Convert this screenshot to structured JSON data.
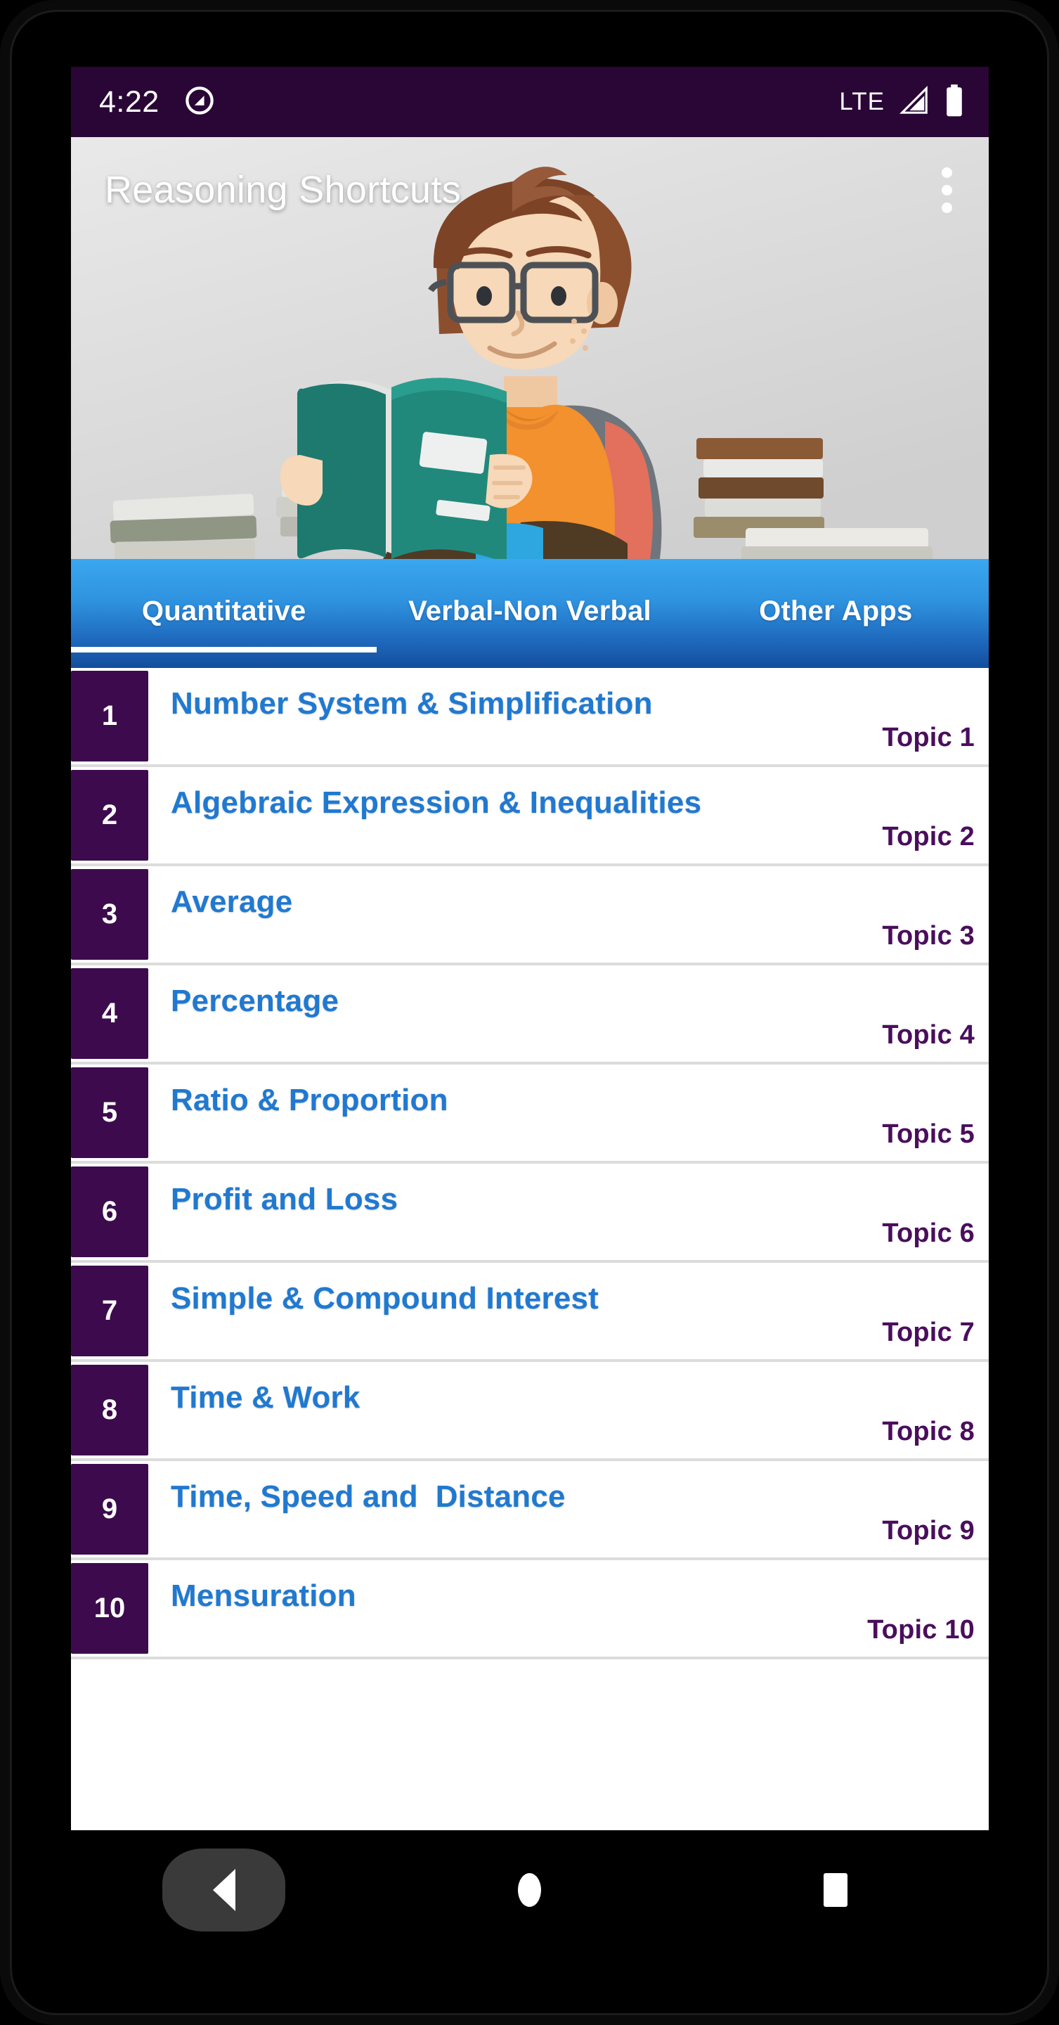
{
  "status_bar": {
    "time": "4:22",
    "dnd_icon": "android-q-circle-icon",
    "network_label": "LTE",
    "signal_icon": "signal-triangle-icon",
    "battery_icon": "battery-full-icon"
  },
  "app_bar": {
    "title": "Reasoning Shortcuts",
    "overflow_icon": "overflow-menu-icon"
  },
  "hero": {
    "illustration_name": "student-reading-book-illustration",
    "background_color": "#e0e0e0"
  },
  "tabs": {
    "active_index": 0,
    "items": [
      {
        "label": "Quantitative"
      },
      {
        "label": "Verbal-Non Verbal"
      },
      {
        "label": "Other Apps"
      }
    ]
  },
  "colors": {
    "status_bar": "#2a0636",
    "badge_purple": "#3d0b4d",
    "title_blue": "#2079d0",
    "topic_purple": "#4a0e5c",
    "tab_blue_top": "#3aa7ef",
    "tab_blue_bottom": "#144d9c"
  },
  "list": {
    "rows": [
      {
        "num": "1",
        "title": "Number System & Simplification",
        "topic": "Topic 1"
      },
      {
        "num": "2",
        "title": "Algebraic Expression & Inequalities",
        "topic": "Topic 2"
      },
      {
        "num": "3",
        "title": "Average",
        "topic": "Topic 3"
      },
      {
        "num": "4",
        "title": "Percentage",
        "topic": "Topic 4"
      },
      {
        "num": "5",
        "title": "Ratio & Proportion",
        "topic": "Topic 5"
      },
      {
        "num": "6",
        "title": "Profit and Loss",
        "topic": "Topic 6"
      },
      {
        "num": "7",
        "title": "Simple & Compound Interest",
        "topic": "Topic 7"
      },
      {
        "num": "8",
        "title": "Time & Work",
        "topic": "Topic 8"
      },
      {
        "num": "9",
        "title": "Time, Speed and  Distance",
        "topic": "Topic 9"
      },
      {
        "num": "10",
        "title": "Mensuration",
        "topic": "Topic 10"
      }
    ]
  },
  "nav_bar": {
    "back_icon": "back-triangle-icon",
    "home_icon": "home-circle-icon",
    "recents_icon": "recents-square-icon"
  }
}
